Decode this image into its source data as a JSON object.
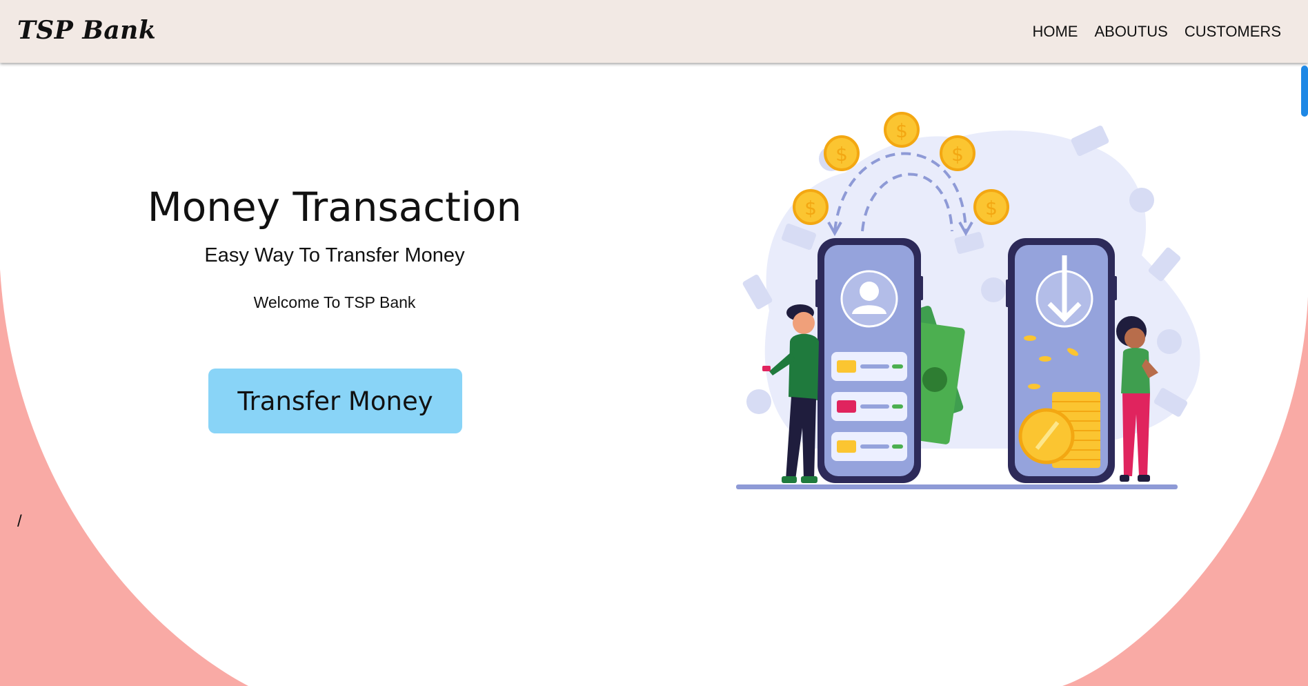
{
  "navbar": {
    "brand": "TSP Bank",
    "links": [
      "HOME",
      "ABOUTUS",
      "CUSTOMERS"
    ]
  },
  "hero": {
    "title": "Money Transaction",
    "subtitle": "Easy Way To Transfer Money",
    "welcome": "Welcome To TSP Bank",
    "cta_label": "Transfer Money"
  },
  "stray_text": "/",
  "illustration": {
    "icons": [
      "dollar-coin-icon",
      "user-profile-icon",
      "download-arrow-icon",
      "credit-card-icon",
      "banknote-icon",
      "coin-stack-icon"
    ]
  },
  "colors": {
    "navbar_bg": "#f2e9e4",
    "page_accent": "#f9aaa5",
    "cta_bg": "#89d4f7",
    "scroll_thumb": "#1e88e5",
    "phone_screen": "#95a3dc",
    "coin": "#fbc531"
  }
}
